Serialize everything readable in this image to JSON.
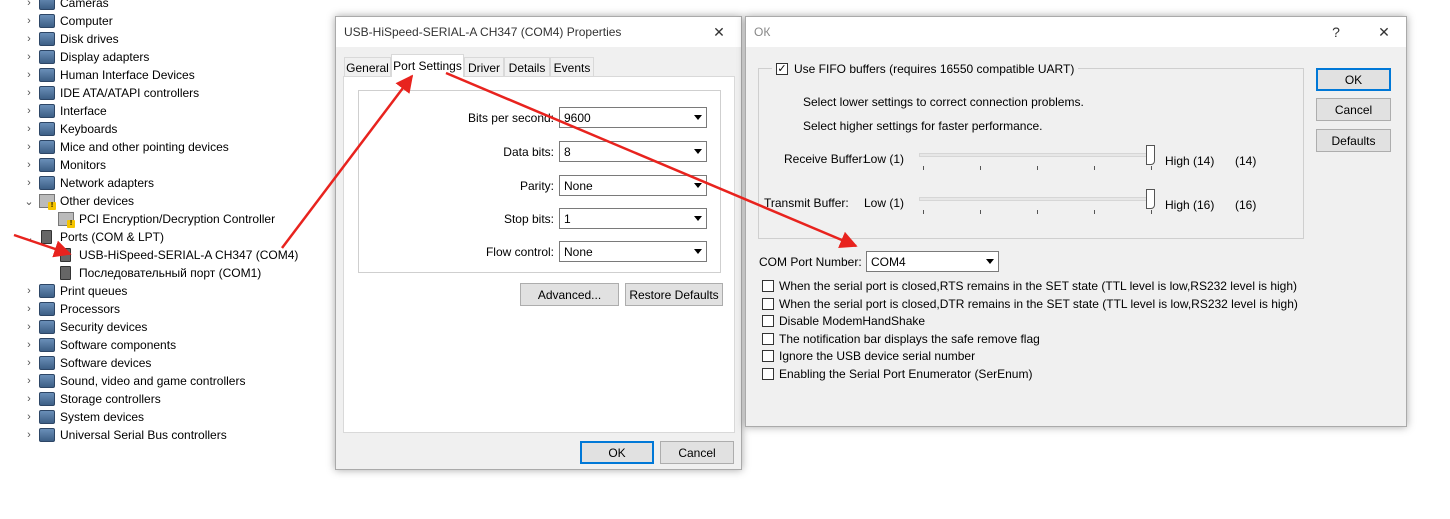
{
  "device_tree": {
    "items": [
      {
        "label": "Cameras",
        "expanded": false,
        "icon": "camera-icon",
        "indent": 0
      },
      {
        "label": "Computer",
        "expanded": false,
        "icon": "computer-icon",
        "indent": 0
      },
      {
        "label": "Disk drives",
        "expanded": false,
        "icon": "disk-icon",
        "indent": 0
      },
      {
        "label": "Display adapters",
        "expanded": false,
        "icon": "display-icon",
        "indent": 0
      },
      {
        "label": "Human Interface Devices",
        "expanded": false,
        "icon": "hid-icon",
        "indent": 0
      },
      {
        "label": "IDE ATA/ATAPI controllers",
        "expanded": false,
        "icon": "ide-icon",
        "indent": 0
      },
      {
        "label": "Interface",
        "expanded": false,
        "icon": "interface-icon",
        "indent": 0
      },
      {
        "label": "Keyboards",
        "expanded": false,
        "icon": "keyboard-icon",
        "indent": 0
      },
      {
        "label": "Mice and other pointing devices",
        "expanded": false,
        "icon": "mouse-icon",
        "indent": 0
      },
      {
        "label": "Monitors",
        "expanded": false,
        "icon": "monitor-icon",
        "indent": 0
      },
      {
        "label": "Network adapters",
        "expanded": false,
        "icon": "network-icon",
        "indent": 0
      },
      {
        "label": "Other devices",
        "expanded": true,
        "icon": "warning-device-icon",
        "indent": 0
      },
      {
        "label": "PCI Encryption/Decryption Controller",
        "icon": "warning-device-icon",
        "indent": 1
      },
      {
        "label": "Ports (COM & LPT)",
        "expanded": true,
        "icon": "port-icon",
        "indent": 0
      },
      {
        "label": "USB-HiSpeed-SERIAL-A CH347 (COM4)",
        "icon": "port-icon",
        "indent": 1
      },
      {
        "label": "Последовательный порт (COM1)",
        "icon": "port-icon",
        "indent": 1
      },
      {
        "label": "Print queues",
        "expanded": false,
        "icon": "printer-icon",
        "indent": 0
      },
      {
        "label": "Processors",
        "expanded": false,
        "icon": "cpu-icon",
        "indent": 0
      },
      {
        "label": "Security devices",
        "expanded": false,
        "icon": "security-icon",
        "indent": 0
      },
      {
        "label": "Software components",
        "expanded": false,
        "icon": "software-icon",
        "indent": 0
      },
      {
        "label": "Software devices",
        "expanded": false,
        "icon": "software-device-icon",
        "indent": 0
      },
      {
        "label": "Sound, video and game controllers",
        "expanded": false,
        "icon": "sound-icon",
        "indent": 0
      },
      {
        "label": "Storage controllers",
        "expanded": false,
        "icon": "storage-icon",
        "indent": 0
      },
      {
        "label": "System devices",
        "expanded": false,
        "icon": "system-icon",
        "indent": 0
      },
      {
        "label": "Universal Serial Bus controllers",
        "expanded": false,
        "icon": "usb-icon",
        "indent": 0
      }
    ]
  },
  "properties": {
    "title": "USB-HiSpeed-SERIAL-A CH347 (COM4) Properties",
    "close_glyph": "✕",
    "tabs": [
      "General",
      "Port Settings",
      "Driver",
      "Details",
      "Events"
    ],
    "active_tab": "Port Settings",
    "fields": [
      {
        "label": "Bits per second:",
        "value": "9600"
      },
      {
        "label": "Data bits:",
        "value": "8"
      },
      {
        "label": "Parity:",
        "value": "None"
      },
      {
        "label": "Stop bits:",
        "value": "1"
      },
      {
        "label": "Flow control:",
        "value": "None"
      }
    ],
    "advanced_label": "Advanced...",
    "restore_label": "Restore Defaults",
    "ok_label": "OK",
    "cancel_label": "Cancel"
  },
  "advanced": {
    "title": "ОК",
    "help_glyph": "?",
    "close_glyph": "✕",
    "fifo_label": "Use FIFO buffers (requires 16550 compatible UART)",
    "fifo_checked": true,
    "hint_lower": "Select lower settings to correct connection problems.",
    "hint_higher": "Select higher settings for faster performance.",
    "receive": {
      "label": "Receive Buffer:",
      "low": "Low (1)",
      "high": "High (14)",
      "current": "(14)",
      "value": 14,
      "max": 14
    },
    "transmit": {
      "label": "Transmit Buffer:",
      "low": "Low (1)",
      "high": "High (16)",
      "current": "(16)",
      "value": 16,
      "max": 16
    },
    "com_port_label": "COM Port Number:",
    "com_port_value": "COM4",
    "options": [
      {
        "label": "When the serial port is closed,RTS remains in the SET state (TTL level is low,RS232 level is high)",
        "checked": false
      },
      {
        "label": "When the serial port is closed,DTR remains in the SET state (TTL level is low,RS232 level is high)",
        "checked": false
      },
      {
        "label": "Disable ModemHandShake",
        "checked": false
      },
      {
        "label": "The notification bar displays the safe remove flag",
        "checked": false
      },
      {
        "label": "Ignore the USB device serial number",
        "checked": false
      },
      {
        "label": "Enabling the Serial Port Enumerator (SerEnum)",
        "checked": false
      }
    ],
    "ok_label": "OK",
    "cancel_label": "Cancel",
    "defaults_label": "Defaults"
  },
  "colors": {
    "annotation_arrow": "#e8231e",
    "focus_blue": "#0078d7"
  }
}
